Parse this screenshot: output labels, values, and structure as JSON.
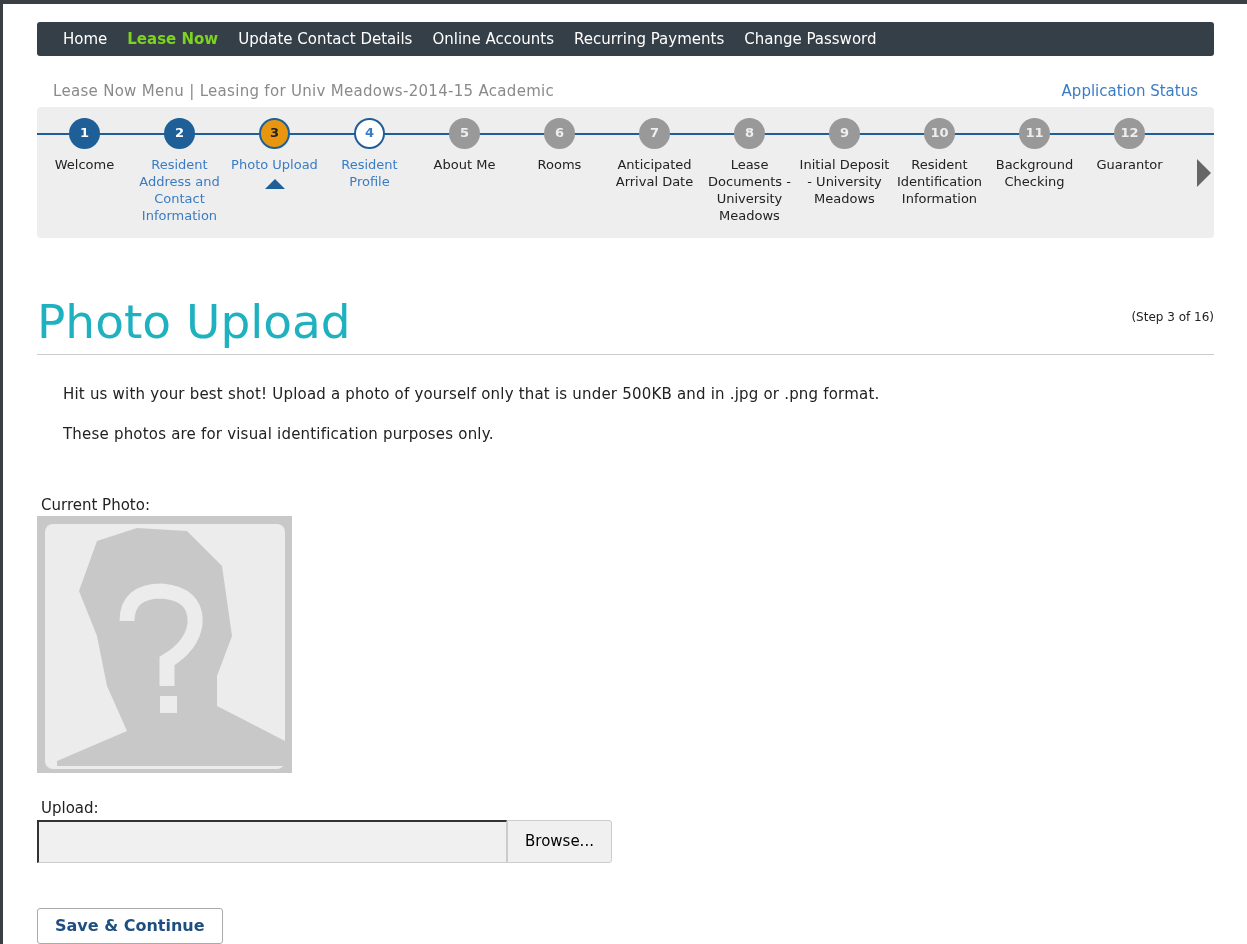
{
  "nav": [
    {
      "label": "Home",
      "selected": false
    },
    {
      "label": "Lease Now",
      "selected": true
    },
    {
      "label": "Update Contact Details",
      "selected": false
    },
    {
      "label": "Online Accounts",
      "selected": false
    },
    {
      "label": "Recurring Payments",
      "selected": false
    },
    {
      "label": "Change Password",
      "selected": false
    }
  ],
  "breadcrumb": "Lease Now Menu | Leasing for Univ Meadows-2014-15 Academic",
  "status_link": "Application Status",
  "steps": [
    {
      "number": "1",
      "label": "Welcome",
      "kind": "done",
      "selected": false
    },
    {
      "number": "2",
      "label": "Resident Address and Contact Information",
      "kind": "done",
      "selected": false
    },
    {
      "number": "3",
      "label": "Photo Upload",
      "kind": "current",
      "selected": true
    },
    {
      "number": "4",
      "label": "Resident Profile",
      "kind": "open",
      "selected": false
    },
    {
      "number": "5",
      "label": "About Me",
      "kind": "locked",
      "selected": false
    },
    {
      "number": "6",
      "label": "Rooms",
      "kind": "locked",
      "selected": false
    },
    {
      "number": "7",
      "label": "Anticipated Arrival Date",
      "kind": "locked",
      "selected": false
    },
    {
      "number": "8",
      "label": "Lease Documents - University Meadows",
      "kind": "locked",
      "selected": false
    },
    {
      "number": "9",
      "label": "Initial Deposit - University Meadows",
      "kind": "locked",
      "selected": false
    },
    {
      "number": "10",
      "label": "Resident Identification Information",
      "kind": "locked",
      "selected": false
    },
    {
      "number": "11",
      "label": "Background Checking",
      "kind": "locked",
      "selected": false
    },
    {
      "number": "12",
      "label": "Guarantor",
      "kind": "locked",
      "selected": false
    }
  ],
  "page_title": "Photo Upload",
  "step_count": "(Step 3 of 16)",
  "paragraphs": [
    "Hit us with your best shot! Upload a photo of yourself only that is under 500KB and in .jpg or .png format.",
    "These photos are for visual identification purposes only."
  ],
  "current_photo_label": "Current Photo:",
  "upload_label": "Upload:",
  "browse_button": "Browse...",
  "save_button": "Save & Continue"
}
